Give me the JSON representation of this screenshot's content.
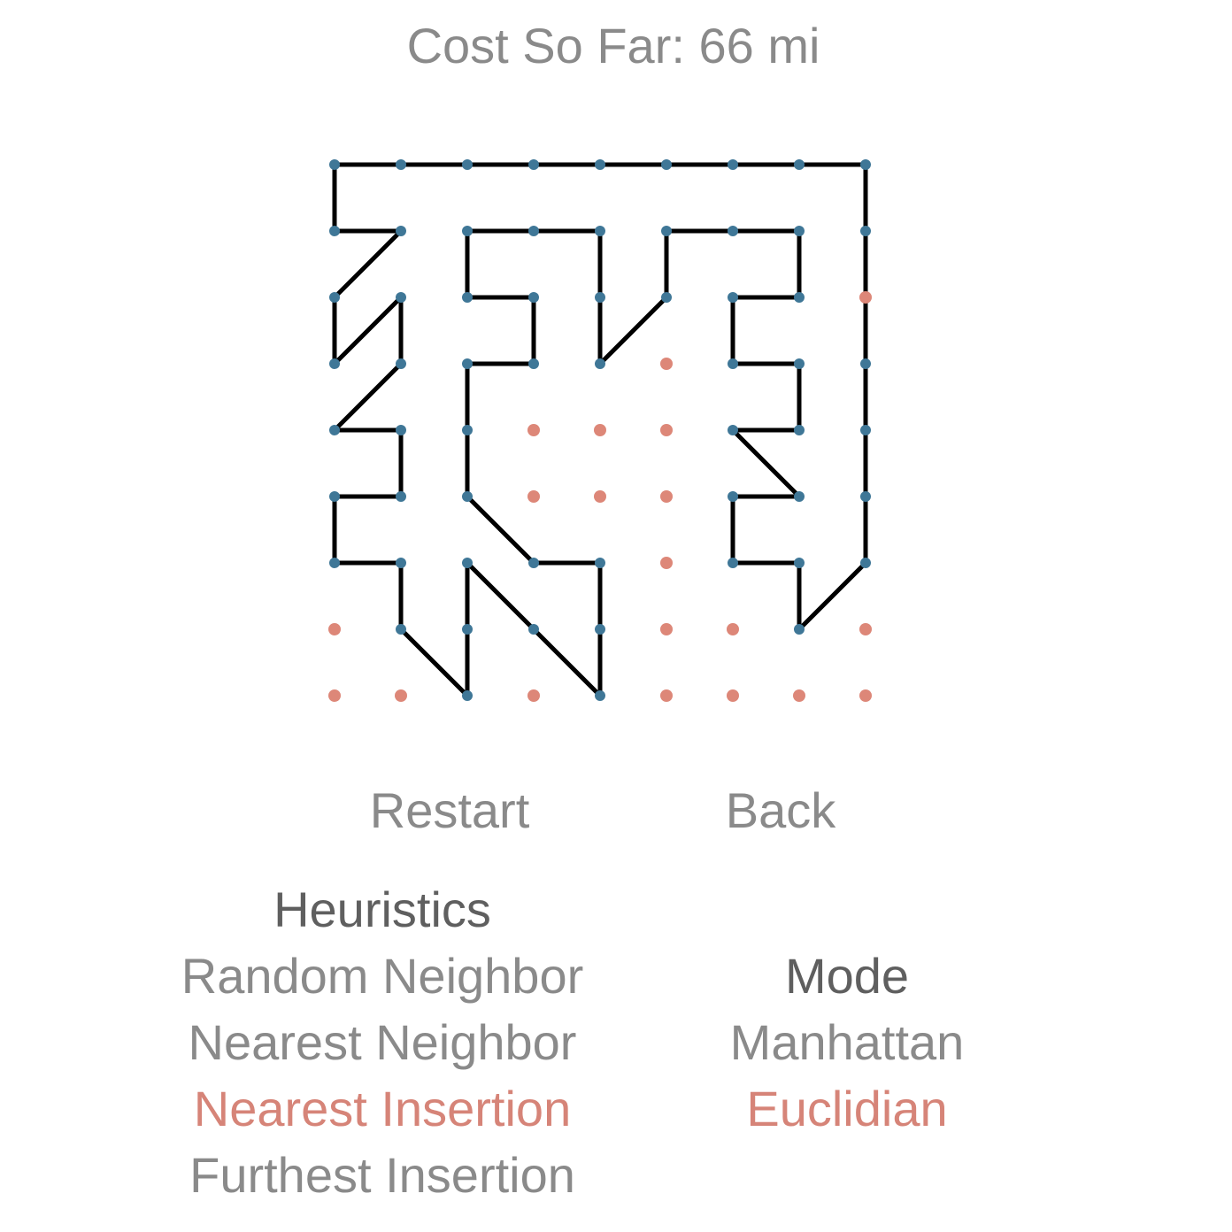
{
  "cost": {
    "label": "Cost So Far: 66 mi"
  },
  "board": {
    "grid_cols": 9,
    "grid_rows": 9,
    "colors": {
      "visited_dot": "#3f7797",
      "unvisited_dot": "#dd8778",
      "path": "#000000"
    },
    "path_nodes": [
      [
        0,
        1
      ],
      [
        1,
        1
      ],
      [
        0,
        2
      ],
      [
        0,
        3
      ],
      [
        1,
        2
      ],
      [
        1,
        3
      ],
      [
        0,
        4
      ],
      [
        1,
        4
      ],
      [
        1,
        5
      ],
      [
        0,
        5
      ],
      [
        0,
        6
      ],
      [
        1,
        6
      ],
      [
        1,
        7
      ],
      [
        2,
        8
      ],
      [
        2,
        6
      ],
      [
        4,
        8
      ],
      [
        4,
        6
      ],
      [
        3,
        6
      ],
      [
        2,
        5
      ],
      [
        2,
        3
      ],
      [
        3,
        3
      ],
      [
        3,
        2
      ],
      [
        2,
        2
      ],
      [
        2,
        1
      ],
      [
        4,
        1
      ],
      [
        4,
        3
      ],
      [
        5,
        2
      ],
      [
        5,
        1
      ],
      [
        7,
        1
      ],
      [
        7,
        2
      ],
      [
        6,
        2
      ],
      [
        6,
        3
      ],
      [
        7,
        3
      ],
      [
        7,
        4
      ],
      [
        6,
        4
      ],
      [
        7,
        5
      ],
      [
        6,
        5
      ],
      [
        6,
        6
      ],
      [
        7,
        6
      ],
      [
        7,
        7
      ],
      [
        8,
        6
      ],
      [
        8,
        0
      ],
      [
        0,
        0
      ],
      [
        0,
        1
      ]
    ],
    "unvisited_nodes": [
      [
        8,
        2
      ],
      [
        5,
        3
      ],
      [
        3,
        4
      ],
      [
        4,
        4
      ],
      [
        5,
        4
      ],
      [
        3,
        5
      ],
      [
        4,
        5
      ],
      [
        5,
        5
      ],
      [
        5,
        6
      ],
      [
        0,
        7
      ],
      [
        5,
        7
      ],
      [
        6,
        7
      ],
      [
        8,
        7
      ],
      [
        0,
        8
      ],
      [
        1,
        8
      ],
      [
        3,
        8
      ],
      [
        5,
        8
      ],
      [
        6,
        8
      ],
      [
        7,
        8
      ],
      [
        8,
        8
      ]
    ]
  },
  "controls": {
    "restart_label": "Restart",
    "back_label": "Back"
  },
  "heuristics": {
    "title": "Heuristics",
    "options": [
      {
        "label": "Random Neighbor",
        "selected": false
      },
      {
        "label": "Nearest Neighbor",
        "selected": false
      },
      {
        "label": "Nearest Insertion",
        "selected": true
      },
      {
        "label": "Furthest Insertion",
        "selected": false
      }
    ]
  },
  "mode": {
    "title": "Mode",
    "options": [
      {
        "label": "Manhattan",
        "selected": false
      },
      {
        "label": "Euclidian",
        "selected": true
      }
    ]
  }
}
